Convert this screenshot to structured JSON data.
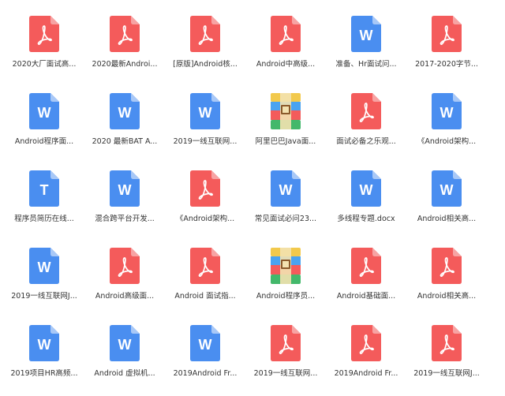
{
  "colors": {
    "pdf": "#f45b5b",
    "word": "#4a8ef0",
    "text_doc": "#4a8ef0",
    "label": "#333333"
  },
  "files": [
    {
      "type": "pdf",
      "icon": "pdf-icon",
      "label": "2020大厂面试高..."
    },
    {
      "type": "pdf",
      "icon": "pdf-icon",
      "label": "2020最新Androi..."
    },
    {
      "type": "pdf",
      "icon": "pdf-icon",
      "label": "[原版]Android核..."
    },
    {
      "type": "pdf",
      "icon": "pdf-icon",
      "label": "Android中高级..."
    },
    {
      "type": "word",
      "icon": "word-icon",
      "label": "准备、Hr面试问..."
    },
    {
      "type": "pdf",
      "icon": "pdf-icon",
      "label": "2017-2020字节..."
    },
    {
      "type": "word",
      "icon": "word-icon",
      "label": "Android程序面..."
    },
    {
      "type": "word",
      "icon": "word-icon",
      "label": "2020 最新BAT A..."
    },
    {
      "type": "word",
      "icon": "word-icon",
      "label": "2019一线互联网..."
    },
    {
      "type": "zip",
      "icon": "archive-icon",
      "label": "阿里巴巴Java面..."
    },
    {
      "type": "pdf",
      "icon": "pdf-icon",
      "label": "面试必备之乐观..."
    },
    {
      "type": "word",
      "icon": "word-icon",
      "label": "《Android架构..."
    },
    {
      "type": "text",
      "icon": "text-doc-icon",
      "label": "程序员简历在线..."
    },
    {
      "type": "word",
      "icon": "word-icon",
      "label": "混合跨平台开发..."
    },
    {
      "type": "pdf",
      "icon": "pdf-icon",
      "label": "《Android架构..."
    },
    {
      "type": "word",
      "icon": "word-icon",
      "label": "常见面试必问23..."
    },
    {
      "type": "word",
      "icon": "word-icon",
      "label": "多线程专题.docx"
    },
    {
      "type": "word",
      "icon": "word-icon",
      "label": "Android相关高..."
    },
    {
      "type": "word",
      "icon": "word-icon",
      "label": "2019一线互联网J..."
    },
    {
      "type": "pdf",
      "icon": "pdf-icon",
      "label": "Android高级面..."
    },
    {
      "type": "pdf",
      "icon": "pdf-icon",
      "label": "Android 面试指..."
    },
    {
      "type": "zip",
      "icon": "archive-icon",
      "label": "Android程序员..."
    },
    {
      "type": "pdf",
      "icon": "pdf-icon",
      "label": "Android基础面..."
    },
    {
      "type": "pdf",
      "icon": "pdf-icon",
      "label": "Android相关高..."
    },
    {
      "type": "word",
      "icon": "word-icon",
      "label": "2019项目HR高频..."
    },
    {
      "type": "word",
      "icon": "word-icon",
      "label": "Android 虚拟机..."
    },
    {
      "type": "word",
      "icon": "word-icon",
      "label": "2019Android Fr..."
    },
    {
      "type": "pdf",
      "icon": "pdf-icon",
      "label": "2019一线互联网..."
    },
    {
      "type": "pdf",
      "icon": "pdf-icon",
      "label": "2019Android Fr..."
    },
    {
      "type": "pdf",
      "icon": "pdf-icon",
      "label": "2019一线互联网J..."
    }
  ]
}
